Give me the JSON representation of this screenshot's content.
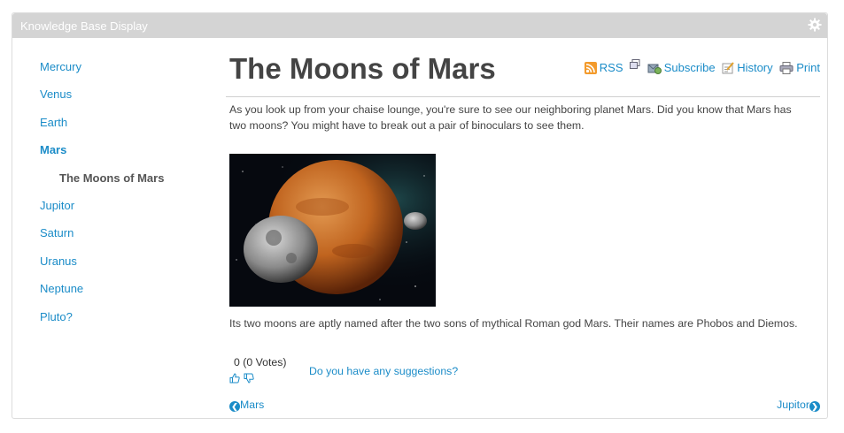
{
  "portlet": {
    "title": "Knowledge Base Display"
  },
  "nav": {
    "items": [
      {
        "label": "Mercury"
      },
      {
        "label": "Venus"
      },
      {
        "label": "Earth"
      },
      {
        "label": "Mars"
      },
      {
        "label": "The Moons of Mars"
      },
      {
        "label": "Jupitor"
      },
      {
        "label": "Saturn"
      },
      {
        "label": "Uranus"
      },
      {
        "label": "Neptune"
      },
      {
        "label": "Pluto?"
      }
    ]
  },
  "article": {
    "title": "The Moons of Mars",
    "tools": {
      "rss": "RSS",
      "subscribe": "Subscribe",
      "history": "History",
      "print": "Print"
    },
    "paragraph1": "As you look up from your chaise lounge, you're sure to see our neighboring planet Mars. Did you know that Mars has two moons? You might have to break out a pair of binoculars to see them.",
    "paragraph2": "Its two moons are aptly named after the two sons of mythical Roman god Mars. Their names are Phobos and Diemos.",
    "rating": "0 (0 Votes)",
    "suggestions": "Do you have any suggestions?",
    "prev": "Mars",
    "next": "Jupitor"
  },
  "colors": {
    "link": "#1b8cc8",
    "header": "#d4d4d4"
  }
}
